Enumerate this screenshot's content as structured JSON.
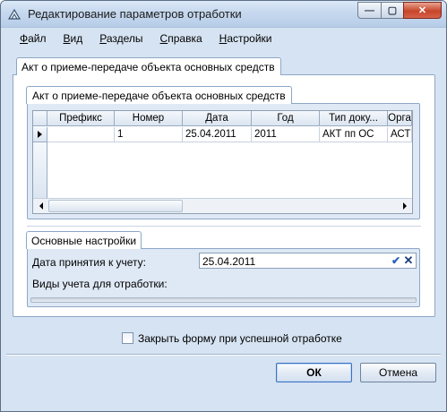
{
  "window": {
    "title": "Редактирование параметров отработки",
    "minimize_glyph": "—",
    "maximize_glyph": "▢",
    "close_glyph": "✕"
  },
  "menu": [
    {
      "label": "Файл",
      "accel": "Ф",
      "rest": "айл"
    },
    {
      "label": "Вид",
      "accel": "В",
      "rest": "ид"
    },
    {
      "label": "Разделы",
      "accel": "Р",
      "rest": "азделы"
    },
    {
      "label": "Справка",
      "accel": "С",
      "rest": "правка"
    },
    {
      "label": "Настройки",
      "accel": "Н",
      "rest": "астройки"
    }
  ],
  "outer_tab": "Акт о приеме-передаче объекта основных средств",
  "inner_tab": "Акт о приеме-передаче объекта основных средств",
  "grid": {
    "columns": [
      "Префикс",
      "Номер",
      "Дата",
      "Год",
      "Тип доку...",
      "Орга"
    ],
    "rows": [
      [
        "",
        "1",
        "25.04.2011",
        "2011",
        "АКТ пп ОС",
        "АСТ"
      ]
    ]
  },
  "settings": {
    "tab": "Основные настройки",
    "date_label": "Дата принятия к учету:",
    "date_value": "25.04.2011",
    "types_label": "Виды учета для отработки:"
  },
  "close_on_success": {
    "label": "Закрыть форму при успешной отработке",
    "checked": false
  },
  "buttons": {
    "ok": "ОК",
    "cancel": "Отмена"
  }
}
